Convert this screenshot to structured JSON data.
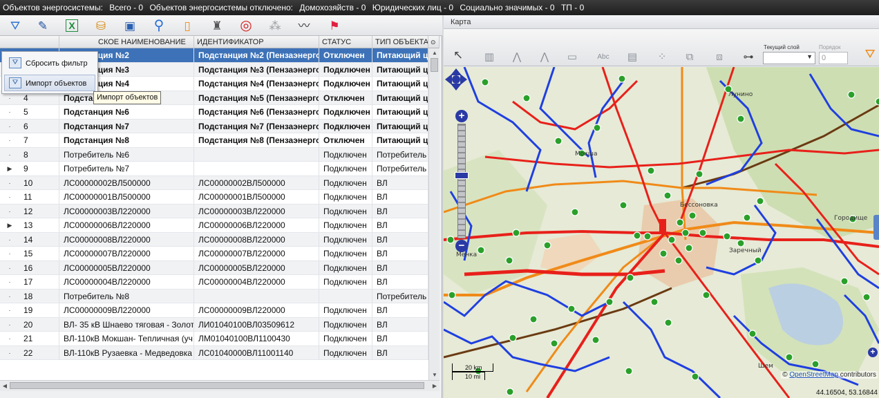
{
  "topbar": {
    "objects_label": "Объектов энергосистемы:",
    "total": "Всего - 0",
    "disconnected": "Объектов энергосистемы отключено:",
    "households": "Домохозяйств - 0",
    "legal": "Юридических лиц - 0",
    "social": "Социально значимых - 0",
    "tp": "ТП - 0"
  },
  "toolbar": {
    "icons": [
      "filter-icon",
      "edit-icon",
      "excel-icon",
      "export-icon",
      "window-icon",
      "search-icon",
      "note-icon",
      "lantern-icon",
      "target-icon",
      "cluster-icon",
      "route-icon",
      "flag-icon"
    ]
  },
  "menu": {
    "reset_filter": "Сбросить фильтр",
    "import_objects": "Импорт объектов"
  },
  "tooltip": "Импорт объектов",
  "grid": {
    "columns": [
      "СКОЕ НАИМЕНОВАНИЕ",
      "ИДЕНТИФИКАТОР",
      "СТАТУС",
      "ТИП ОБЪЕКТА"
    ],
    "rows": [
      {
        "ind": "",
        "n": "",
        "name": "Подстанция №2",
        "id": "Подстанция №2 (Пензаэнерго)",
        "status": "Отключен",
        "type": "Питающий цен",
        "bold": true,
        "selected": true
      },
      {
        "ind": "",
        "n": "",
        "name": "Подстанция №3",
        "id": "Подстанция №3 (Пензаэнерго)",
        "status": "Подключен",
        "type": "Питающий цен",
        "bold": true
      },
      {
        "ind": "·",
        "n": "3",
        "name": "Подстанция №4",
        "id": "Подстанция №4 (Пензаэнерго)",
        "status": "Подключен",
        "type": "Питающий цен",
        "bold": true
      },
      {
        "ind": "·",
        "n": "4",
        "name": "Подстанция №5",
        "id": "Подстанция №5 (Пензаэнерго)",
        "status": "Отключен",
        "type": "Питающий цен",
        "bold": true
      },
      {
        "ind": "·",
        "n": "5",
        "name": "Подстанция №6",
        "id": "Подстанция №6 (Пензаэнерго)",
        "status": "Подключен",
        "type": "Питающий цен",
        "bold": true
      },
      {
        "ind": "·",
        "n": "6",
        "name": "Подстанция №7",
        "id": "Подстанция №7 (Пензаэнерго)",
        "status": "Подключен",
        "type": "Питающий цен",
        "bold": true
      },
      {
        "ind": "·",
        "n": "7",
        "name": "Подстанция №8",
        "id": "Подстанция №8 (Пензаэнерго)",
        "status": "Отключен",
        "type": "Питающий цен",
        "bold": true
      },
      {
        "ind": "·",
        "n": "8",
        "name": "Потребитель №6",
        "id": "",
        "status": "Подключен",
        "type": "Потребитель",
        "bold": false
      },
      {
        "ind": "▶",
        "n": "9",
        "name": "Потребитель №7",
        "id": "",
        "status": "Подключен",
        "type": "Потребитель",
        "bold": false
      },
      {
        "ind": "·",
        "n": "10",
        "name": "ЛС00000002ВЛ500000",
        "id": "ЛС00000002ВЛ500000",
        "status": "Подключен",
        "type": "ВЛ",
        "bold": false
      },
      {
        "ind": "·",
        "n": "11",
        "name": "ЛС00000001ВЛ500000",
        "id": "ЛС00000001ВЛ500000",
        "status": "Подключен",
        "type": "ВЛ",
        "bold": false
      },
      {
        "ind": "·",
        "n": "12",
        "name": "ЛС00000003ВЛ220000",
        "id": "ЛС00000003ВЛ220000",
        "status": "Подключен",
        "type": "ВЛ",
        "bold": false
      },
      {
        "ind": "▶",
        "n": "13",
        "name": "ЛС00000006ВЛ220000",
        "id": "ЛС00000006ВЛ220000",
        "status": "Подключен",
        "type": "ВЛ",
        "bold": false
      },
      {
        "ind": "·",
        "n": "14",
        "name": "ЛС00000008ВЛ220000",
        "id": "ЛС00000008ВЛ220000",
        "status": "Подключен",
        "type": "ВЛ",
        "bold": false
      },
      {
        "ind": "·",
        "n": "15",
        "name": "ЛС00000007ВЛ220000",
        "id": "ЛС00000007ВЛ220000",
        "status": "Подключен",
        "type": "ВЛ",
        "bold": false
      },
      {
        "ind": "·",
        "n": "16",
        "name": "ЛС00000005ВЛ220000",
        "id": "ЛС00000005ВЛ220000",
        "status": "Подключен",
        "type": "ВЛ",
        "bold": false
      },
      {
        "ind": "·",
        "n": "17",
        "name": "ЛС00000004ВЛ220000",
        "id": "ЛС00000004ВЛ220000",
        "status": "Подключен",
        "type": "ВЛ",
        "bold": false
      },
      {
        "ind": "·",
        "n": "18",
        "name": "Потребитель №8",
        "id": "",
        "status": "",
        "type": "Потребитель",
        "bold": false
      },
      {
        "ind": "·",
        "n": "19",
        "name": "ЛС00000009ВЛ220000",
        "id": "ЛС00000009ВЛ220000",
        "status": "Подключен",
        "type": "ВЛ",
        "bold": false
      },
      {
        "ind": "·",
        "n": "20",
        "name": "ВЛ- 35 кВ Шнаево тяговая - Золот",
        "id": "ЛИ01040100ВЛ03509612",
        "status": "Подключен",
        "type": "ВЛ",
        "bold": false
      },
      {
        "ind": "·",
        "n": "21",
        "name": "ВЛ-110кВ Мокшан- Тепличная (уч",
        "id": "ЛМ01040100ВЛ1100430",
        "status": "Подключен",
        "type": "ВЛ",
        "bold": false
      },
      {
        "ind": "·",
        "n": "22",
        "name": "ВЛ-110кВ Рузаевка - Медведовка",
        "id": "ЛС01040000ВЛ11001140",
        "status": "Подключен",
        "type": "ВЛ",
        "bold": false
      }
    ]
  },
  "map": {
    "title": "Карта",
    "layer_label": "Текущий слой",
    "order_label": "Порядок",
    "order_value": "0",
    "attribution_prefix": "©",
    "attribution_link": "OpenStreetMap",
    "attribution_suffix": "contributors",
    "coords": "44.16504, 53.16844",
    "scale_km": "20 km",
    "scale_mi": "10 mi",
    "place_labels": [
      "Мокша",
      "Бессоновка",
      "Заречный",
      "Менка",
      "Лунино",
      "Городище",
      "Шем"
    ],
    "colors": {
      "red": "#e8201a",
      "blue": "#1f3fe0",
      "orange": "#f08a18",
      "brown": "#6b3a12",
      "node": "#2aa02a"
    }
  }
}
